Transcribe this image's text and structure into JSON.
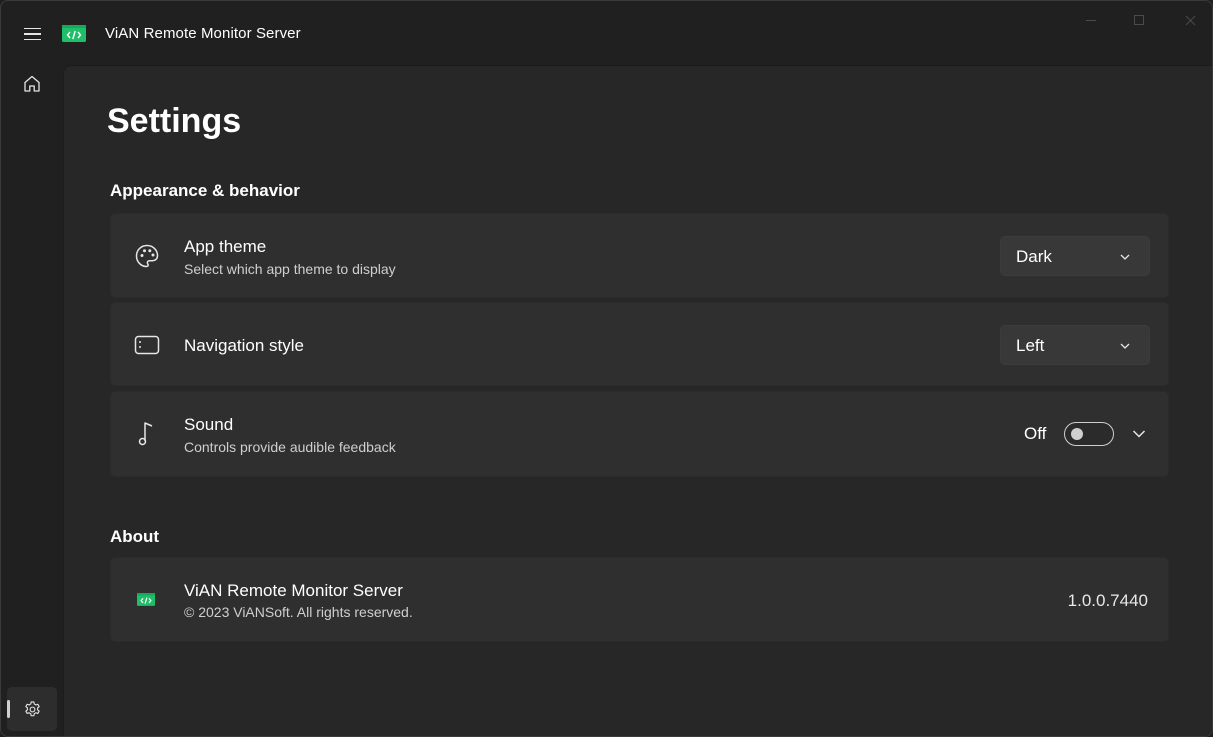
{
  "app": {
    "title": "ViAN Remote Monitor Server",
    "logo_icon": "code-logo-icon",
    "brand_color": "#1fbf6a"
  },
  "nav": {
    "menu_icon": "hamburger-icon",
    "items": [
      {
        "name": "home",
        "icon": "home-icon",
        "selected": false
      },
      {
        "name": "settings",
        "icon": "gear-icon",
        "selected": true
      }
    ]
  },
  "page": {
    "title": "Settings"
  },
  "appearance": {
    "header": "Appearance & behavior",
    "app_theme": {
      "icon": "palette-icon",
      "title": "App theme",
      "description": "Select which app theme to display",
      "value": "Dark"
    },
    "navigation_style": {
      "icon": "window-icon",
      "title": "Navigation style",
      "value": "Left"
    },
    "sound": {
      "icon": "music-note-icon",
      "title": "Sound",
      "description": "Controls provide audible feedback",
      "state_label": "Off",
      "enabled": false
    }
  },
  "about": {
    "header": "About",
    "app_name": "ViAN Remote Monitor Server",
    "copyright": "© 2023 ViANSoft. All rights reserved.",
    "version": "1.0.0.7440"
  }
}
